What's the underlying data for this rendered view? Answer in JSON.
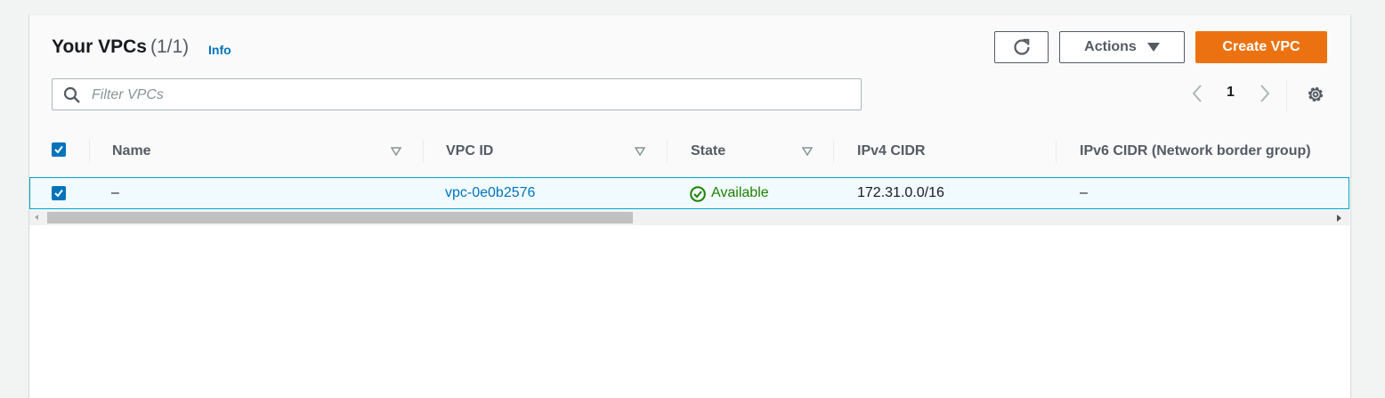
{
  "header": {
    "title": "Your VPCs",
    "count": "(1/1)",
    "info_link": "Info"
  },
  "toolbar": {
    "refresh_icon": "refresh-icon",
    "actions_label": "Actions",
    "create_label": "Create VPC",
    "create_color": "#ec7211"
  },
  "search": {
    "placeholder": "Filter VPCs",
    "value": ""
  },
  "pagination": {
    "current_page": "1"
  },
  "table": {
    "columns": [
      "Name",
      "VPC ID",
      "State",
      "IPv4 CIDR",
      "IPv6 CIDR (Network border group)"
    ],
    "header_checkbox_checked": true,
    "rows": [
      {
        "selected": true,
        "name": "–",
        "vpc_id": "vpc-0e0b2576",
        "state": "Available",
        "ipv4_cidr": "172.31.0.0/16",
        "ipv6_cidr": "–"
      }
    ]
  },
  "colors": {
    "accent": "#0073bb",
    "status_ok": "#1d8102",
    "selected_row_bg": "#f1faff",
    "selected_row_border": "#00a1c9"
  }
}
